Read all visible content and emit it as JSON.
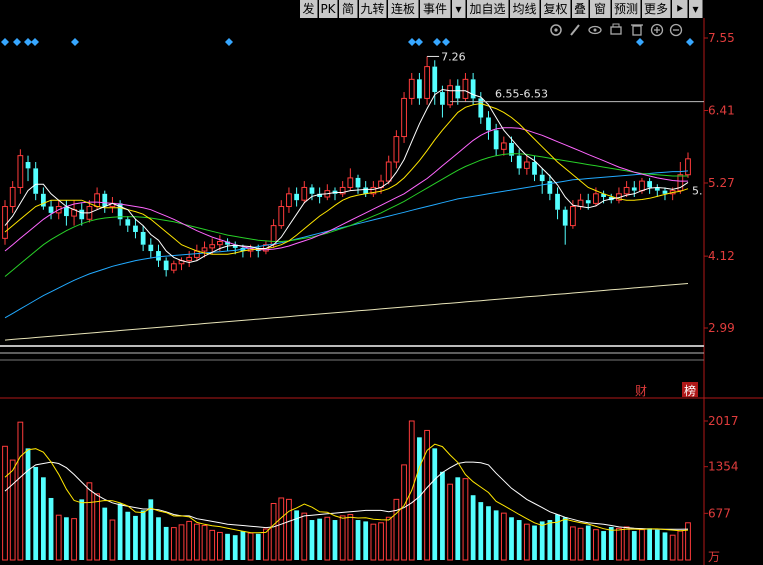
{
  "toolbar": {
    "buttons": [
      {
        "name": "fa",
        "label": "发"
      },
      {
        "name": "pk",
        "label": "PK"
      },
      {
        "name": "jian",
        "label": "简"
      },
      {
        "name": "jiuzhuan",
        "label": "九转"
      },
      {
        "name": "lianban",
        "label": "连板"
      },
      {
        "name": "shijian",
        "label": "事件"
      },
      {
        "name": "dropdown",
        "label": "▾"
      },
      {
        "name": "jiazixuan",
        "label": "加自选"
      },
      {
        "name": "junxian",
        "label": "均线"
      },
      {
        "name": "fuquan",
        "label": "复权"
      },
      {
        "name": "die",
        "label": "叠"
      },
      {
        "name": "chuang",
        "label": "窗"
      },
      {
        "name": "yuce",
        "label": "预测"
      },
      {
        "name": "gengduo",
        "label": "更多"
      },
      {
        "name": "flag",
        "label": "⯈"
      },
      {
        "name": "dropdown2",
        "label": "▾"
      }
    ]
  },
  "colors": {
    "up": "#ff3c3c",
    "down": "#54ffff",
    "axis": "#b01818",
    "ma5": "#ffffff",
    "ma10": "#ffe600",
    "ma20": "#ff66ff",
    "ma30": "#28d028",
    "ma60": "#22aaff",
    "ma250": "#e8e4b8",
    "marker": "#37a7ff"
  },
  "icons": [
    "gear-icon",
    "pencil-icon",
    "eye-icon",
    "print-icon",
    "trash-icon",
    "zoom-in-icon",
    "zoom-out-icon"
  ],
  "price_axis": {
    "ticks": [
      "7.55",
      "6.41",
      "5.27",
      "4.12",
      "2.99"
    ]
  },
  "volume_axis": {
    "ticks": [
      "2017",
      "1354",
      "677"
    ],
    "unit": "万"
  },
  "annotations": {
    "high": "7.26",
    "range": "6.55-6.53",
    "last": "5."
  },
  "badges": {
    "cai": "财",
    "bang": "榜"
  },
  "chart_data": {
    "type": "candlestick",
    "ylim": [
      2.99,
      7.55
    ],
    "volume_ylim": [
      0,
      2017
    ],
    "candles": [
      [
        4.4,
        4.9,
        4.3,
        5.0
      ],
      [
        4.9,
        5.2,
        4.8,
        5.3
      ],
      [
        5.2,
        5.7,
        5.1,
        5.8
      ],
      [
        5.6,
        5.5,
        5.3,
        5.7
      ],
      [
        5.5,
        5.1,
        5.0,
        5.6
      ],
      [
        5.1,
        4.9,
        4.85,
        5.2
      ],
      [
        4.9,
        4.8,
        4.7,
        5.0
      ],
      [
        4.8,
        4.9,
        4.7,
        5.0
      ],
      [
        4.9,
        4.75,
        4.6,
        5.0
      ],
      [
        4.75,
        4.85,
        4.6,
        5.0
      ],
      [
        4.85,
        4.7,
        4.6,
        4.95
      ],
      [
        4.7,
        4.9,
        4.65,
        5.0
      ],
      [
        4.9,
        5.1,
        4.85,
        5.2
      ],
      [
        5.1,
        4.9,
        4.8,
        5.15
      ],
      [
        4.9,
        4.95,
        4.8,
        5.05
      ],
      [
        4.95,
        4.7,
        4.6,
        5.0
      ],
      [
        4.7,
        4.6,
        4.5,
        4.75
      ],
      [
        4.6,
        4.5,
        4.4,
        4.7
      ],
      [
        4.5,
        4.3,
        4.2,
        4.6
      ],
      [
        4.3,
        4.2,
        4.1,
        4.4
      ],
      [
        4.2,
        4.05,
        3.95,
        4.3
      ],
      [
        4.05,
        3.9,
        3.8,
        4.1
      ],
      [
        3.9,
        4.0,
        3.85,
        4.05
      ],
      [
        4.0,
        4.05,
        3.9,
        4.1
      ],
      [
        4.05,
        4.1,
        3.95,
        4.2
      ],
      [
        4.1,
        4.2,
        4.05,
        4.3
      ],
      [
        4.2,
        4.25,
        4.1,
        4.35
      ],
      [
        4.25,
        4.3,
        4.15,
        4.4
      ],
      [
        4.3,
        4.35,
        4.2,
        4.45
      ],
      [
        4.35,
        4.3,
        4.2,
        4.4
      ],
      [
        4.3,
        4.25,
        4.15,
        4.35
      ],
      [
        4.25,
        4.2,
        4.1,
        4.3
      ],
      [
        4.2,
        4.25,
        4.1,
        4.3
      ],
      [
        4.25,
        4.2,
        4.1,
        4.3
      ],
      [
        4.2,
        4.3,
        4.15,
        4.35
      ],
      [
        4.3,
        4.6,
        4.25,
        4.7
      ],
      [
        4.6,
        4.9,
        4.55,
        5.0
      ],
      [
        4.9,
        5.1,
        4.8,
        5.2
      ],
      [
        5.1,
        5.0,
        4.9,
        5.2
      ],
      [
        5.0,
        5.2,
        4.95,
        5.3
      ],
      [
        5.2,
        5.1,
        5.0,
        5.25
      ],
      [
        5.1,
        5.05,
        4.95,
        5.2
      ],
      [
        5.05,
        5.15,
        5.0,
        5.25
      ],
      [
        5.15,
        5.1,
        5.0,
        5.2
      ],
      [
        5.1,
        5.2,
        5.05,
        5.3
      ],
      [
        5.2,
        5.35,
        5.15,
        5.5
      ],
      [
        5.35,
        5.2,
        5.1,
        5.4
      ],
      [
        5.2,
        5.1,
        5.05,
        5.3
      ],
      [
        5.1,
        5.2,
        5.05,
        5.3
      ],
      [
        5.2,
        5.3,
        5.1,
        5.4
      ],
      [
        5.3,
        5.6,
        5.25,
        5.7
      ],
      [
        5.6,
        6.0,
        5.5,
        6.1
      ],
      [
        6.0,
        6.6,
        5.9,
        6.7
      ],
      [
        6.6,
        6.9,
        6.5,
        7.0
      ],
      [
        6.9,
        6.6,
        6.5,
        7.0
      ],
      [
        6.6,
        7.1,
        6.5,
        7.26
      ],
      [
        7.1,
        6.7,
        6.5,
        7.2
      ],
      [
        6.7,
        6.5,
        6.3,
        6.8
      ],
      [
        6.5,
        6.8,
        6.45,
        6.9
      ],
      [
        6.8,
        6.6,
        6.5,
        6.9
      ],
      [
        6.6,
        6.9,
        6.55,
        7.0
      ],
      [
        6.9,
        6.6,
        6.5,
        7.0
      ],
      [
        6.6,
        6.3,
        6.2,
        6.7
      ],
      [
        6.3,
        6.1,
        5.95,
        6.4
      ],
      [
        6.1,
        5.8,
        5.7,
        6.2
      ],
      [
        5.8,
        5.9,
        5.7,
        6.0
      ],
      [
        5.9,
        5.7,
        5.6,
        6.0
      ],
      [
        5.7,
        5.5,
        5.4,
        5.8
      ],
      [
        5.5,
        5.6,
        5.4,
        5.7
      ],
      [
        5.6,
        5.4,
        5.3,
        5.7
      ],
      [
        5.4,
        5.3,
        5.1,
        5.5
      ],
      [
        5.3,
        5.1,
        5.0,
        5.4
      ],
      [
        5.1,
        4.85,
        4.7,
        5.2
      ],
      [
        4.85,
        4.6,
        4.3,
        4.9
      ],
      [
        4.6,
        4.9,
        4.55,
        5.0
      ],
      [
        4.9,
        5.0,
        4.85,
        5.1
      ],
      [
        5.0,
        4.95,
        4.85,
        5.1
      ],
      [
        4.95,
        5.1,
        4.9,
        5.2
      ],
      [
        5.1,
        5.05,
        4.95,
        5.15
      ],
      [
        5.05,
        5.0,
        4.95,
        5.1
      ],
      [
        5.0,
        5.1,
        4.95,
        5.2
      ],
      [
        5.1,
        5.2,
        5.05,
        5.3
      ],
      [
        5.2,
        5.15,
        5.05,
        5.3
      ],
      [
        5.15,
        5.3,
        5.1,
        5.35
      ],
      [
        5.3,
        5.2,
        5.1,
        5.35
      ],
      [
        5.2,
        5.15,
        5.05,
        5.25
      ],
      [
        5.15,
        5.1,
        5.0,
        5.2
      ],
      [
        5.1,
        5.15,
        5.0,
        5.2
      ],
      [
        5.15,
        5.4,
        5.1,
        5.6
      ],
      [
        5.4,
        5.65,
        5.35,
        5.75
      ]
    ],
    "volumes": [
      1650,
      1450,
      2000,
      1620,
      1350,
      1200,
      900,
      650,
      620,
      600,
      880,
      1120,
      960,
      760,
      580,
      820,
      700,
      640,
      720,
      880,
      620,
      480,
      470,
      510,
      560,
      520,
      500,
      430,
      400,
      380,
      360,
      420,
      390,
      380,
      450,
      820,
      900,
      880,
      720,
      680,
      580,
      600,
      620,
      580,
      640,
      660,
      580,
      560,
      520,
      540,
      620,
      880,
      1380,
      2017,
      1780,
      1880,
      1620,
      1280,
      1100,
      1200,
      1180,
      940,
      840,
      780,
      720,
      680,
      620,
      580,
      520,
      500,
      560,
      580,
      660,
      620,
      480,
      460,
      500,
      440,
      420,
      480,
      460,
      480,
      420,
      440,
      460,
      440,
      400,
      360,
      420,
      540
    ],
    "ma5": [
      4.6,
      4.75,
      4.95,
      5.15,
      5.25,
      5.25,
      5.1,
      5.0,
      4.9,
      4.85,
      4.8,
      4.8,
      4.85,
      4.9,
      4.95,
      4.9,
      4.85,
      4.7,
      4.6,
      4.46,
      4.37,
      4.2,
      4.1,
      4.05,
      4.02,
      4.05,
      4.12,
      4.18,
      4.24,
      4.28,
      4.29,
      4.28,
      4.27,
      4.24,
      4.24,
      4.3,
      4.42,
      4.6,
      4.78,
      4.96,
      5.06,
      5.09,
      5.1,
      5.12,
      5.12,
      5.15,
      5.16,
      5.17,
      5.17,
      5.2,
      5.28,
      5.44,
      5.64,
      5.92,
      6.2,
      6.44,
      6.66,
      6.74,
      6.72,
      6.72,
      6.72,
      6.66,
      6.62,
      6.5,
      6.3,
      6.1,
      5.96,
      5.82,
      5.7,
      5.62,
      5.5,
      5.38,
      5.24,
      5.05,
      4.92,
      4.9,
      4.88,
      4.91,
      4.99,
      5.02,
      5.04,
      5.08,
      5.1,
      5.15,
      5.19,
      5.2,
      5.19,
      5.17,
      5.2,
      5.28
    ],
    "ma10": [
      4.5,
      4.6,
      4.7,
      4.8,
      4.9,
      4.95,
      5.0,
      5.0,
      5.0,
      5.0,
      5.0,
      4.95,
      4.9,
      4.88,
      4.88,
      4.88,
      4.85,
      4.82,
      4.78,
      4.7,
      4.6,
      4.5,
      4.4,
      4.3,
      4.25,
      4.2,
      4.17,
      4.15,
      4.15,
      4.15,
      4.17,
      4.2,
      4.22,
      4.23,
      4.24,
      4.26,
      4.3,
      4.36,
      4.45,
      4.55,
      4.65,
      4.75,
      4.83,
      4.92,
      5.0,
      5.05,
      5.08,
      5.1,
      5.12,
      5.14,
      5.18,
      5.25,
      5.35,
      5.48,
      5.62,
      5.78,
      5.95,
      6.1,
      6.24,
      6.38,
      6.46,
      6.5,
      6.52,
      6.48,
      6.44,
      6.38,
      6.3,
      6.2,
      6.08,
      5.96,
      5.84,
      5.72,
      5.6,
      5.5,
      5.4,
      5.3,
      5.2,
      5.15,
      5.1,
      5.06,
      5.02,
      5.0,
      5.0,
      5.01,
      5.03,
      5.06,
      5.09,
      5.12,
      5.14,
      5.18
    ],
    "ma20": [
      4.2,
      4.3,
      4.4,
      4.5,
      4.6,
      4.7,
      4.78,
      4.85,
      4.9,
      4.94,
      4.96,
      4.97,
      4.97,
      4.96,
      4.95,
      4.94,
      4.92,
      4.9,
      4.88,
      4.85,
      4.8,
      4.75,
      4.7,
      4.64,
      4.58,
      4.52,
      4.47,
      4.42,
      4.38,
      4.34,
      4.3,
      4.27,
      4.24,
      4.22,
      4.22,
      4.23,
      4.25,
      4.28,
      4.32,
      4.36,
      4.4,
      4.45,
      4.5,
      4.56,
      4.62,
      4.68,
      4.74,
      4.8,
      4.86,
      4.92,
      4.98,
      5.04,
      5.1,
      5.18,
      5.26,
      5.34,
      5.44,
      5.54,
      5.64,
      5.74,
      5.84,
      5.94,
      6.02,
      6.08,
      6.12,
      6.14,
      6.14,
      6.13,
      6.1,
      6.06,
      6.02,
      5.97,
      5.92,
      5.87,
      5.82,
      5.77,
      5.72,
      5.67,
      5.62,
      5.57,
      5.52,
      5.48,
      5.44,
      5.41,
      5.38,
      5.35,
      5.33,
      5.31,
      5.3,
      5.3
    ],
    "ma30": [
      3.8,
      3.9,
      4.0,
      4.1,
      4.2,
      4.3,
      4.38,
      4.45,
      4.52,
      4.58,
      4.63,
      4.67,
      4.7,
      4.72,
      4.73,
      4.74,
      4.74,
      4.74,
      4.73,
      4.72,
      4.7,
      4.68,
      4.66,
      4.63,
      4.6,
      4.57,
      4.54,
      4.51,
      4.48,
      4.45,
      4.43,
      4.41,
      4.39,
      4.37,
      4.36,
      4.35,
      4.35,
      4.36,
      4.38,
      4.4,
      4.42,
      4.45,
      4.48,
      4.52,
      4.56,
      4.6,
      4.65,
      4.7,
      4.75,
      4.8,
      4.86,
      4.92,
      4.98,
      5.05,
      5.12,
      5.19,
      5.26,
      5.33,
      5.4,
      5.47,
      5.53,
      5.58,
      5.63,
      5.67,
      5.7,
      5.72,
      5.73,
      5.73,
      5.72,
      5.7,
      5.68,
      5.66,
      5.64,
      5.62,
      5.6,
      5.58,
      5.56,
      5.54,
      5.52,
      5.5,
      5.48,
      5.46,
      5.44,
      5.42,
      5.41,
      5.4,
      5.39,
      5.38,
      5.38,
      5.38
    ],
    "ma60": [
      3.15,
      3.22,
      3.29,
      3.36,
      3.43,
      3.5,
      3.56,
      3.62,
      3.68,
      3.74,
      3.79,
      3.84,
      3.88,
      3.92,
      3.96,
      3.99,
      4.02,
      4.05,
      4.07,
      4.09,
      4.11,
      4.12,
      4.13,
      4.14,
      4.15,
      4.16,
      4.17,
      4.18,
      4.19,
      4.2,
      4.21,
      4.23,
      4.25,
      4.27,
      4.29,
      4.31,
      4.33,
      4.36,
      4.39,
      4.42,
      4.45,
      4.48,
      4.51,
      4.54,
      4.57,
      4.6,
      4.63,
      4.66,
      4.69,
      4.72,
      4.75,
      4.78,
      4.81,
      4.84,
      4.87,
      4.9,
      4.93,
      4.96,
      4.99,
      5.02,
      5.04,
      5.06,
      5.08,
      5.1,
      5.12,
      5.14,
      5.16,
      5.18,
      5.2,
      5.22,
      5.24,
      5.26,
      5.28,
      5.3,
      5.32,
      5.33,
      5.34,
      5.35,
      5.36,
      5.37,
      5.38,
      5.39,
      5.4,
      5.41,
      5.42,
      5.43,
      5.44,
      5.45,
      5.45,
      5.46
    ],
    "ma250": [
      2.8,
      2.81,
      2.82,
      2.83,
      2.84,
      2.85,
      2.86,
      2.87,
      2.88,
      2.89,
      2.9,
      2.91,
      2.92,
      2.93,
      2.94,
      2.95,
      2.96,
      2.97,
      2.98,
      2.99,
      3.0,
      3.01,
      3.02,
      3.03,
      3.04,
      3.05,
      3.06,
      3.07,
      3.08,
      3.09,
      3.1,
      3.11,
      3.12,
      3.13,
      3.14,
      3.15,
      3.16,
      3.17,
      3.18,
      3.19,
      3.2,
      3.21,
      3.22,
      3.23,
      3.24,
      3.25,
      3.26,
      3.27,
      3.28,
      3.29,
      3.3,
      3.31,
      3.32,
      3.33,
      3.34,
      3.35,
      3.36,
      3.37,
      3.38,
      3.39,
      3.4,
      3.41,
      3.42,
      3.43,
      3.44,
      3.45,
      3.46,
      3.47,
      3.48,
      3.49,
      3.5,
      3.51,
      3.52,
      3.53,
      3.54,
      3.55,
      3.56,
      3.57,
      3.58,
      3.59,
      3.6,
      3.61,
      3.62,
      3.63,
      3.64,
      3.65,
      3.66,
      3.67,
      3.68,
      3.69
    ],
    "vol_ma5": [
      1200,
      1300,
      1500,
      1600,
      1615,
      1564,
      1424,
      1244,
      1028,
      864,
      830,
      834,
      847,
      864,
      860,
      828,
      784,
      696,
      688,
      752,
      712,
      688,
      638,
      640,
      626,
      546,
      518,
      498,
      484,
      462,
      438,
      418,
      398,
      394,
      400,
      510,
      612,
      706,
      756,
      812,
      766,
      700,
      694,
      640,
      606,
      620,
      610,
      614,
      592,
      584,
      580,
      676,
      790,
      1010,
      1346,
      1592,
      1680,
      1646,
      1524,
      1416,
      1240,
      1136,
      1058,
      980,
      852,
      790,
      726,
      660,
      600,
      540,
      500,
      538,
      548,
      594,
      564,
      540,
      522,
      488,
      454,
      432,
      436,
      450,
      448,
      444,
      452,
      452,
      442,
      434,
      424,
      434
    ],
    "vol_ma10": [
      1000,
      1100,
      1200,
      1300,
      1380,
      1400,
      1420,
      1400,
      1340,
      1240,
      1130,
      1020,
      940,
      880,
      830,
      800,
      780,
      760,
      740,
      740,
      730,
      700,
      660,
      640,
      640,
      600,
      580,
      560,
      540,
      520,
      510,
      500,
      490,
      480,
      470,
      480,
      520,
      560,
      600,
      640,
      650,
      660,
      670,
      680,
      690,
      700,
      710,
      720,
      720,
      720,
      700,
      720,
      760,
      830,
      920,
      1050,
      1170,
      1270,
      1340,
      1400,
      1420,
      1420,
      1410,
      1380,
      1260,
      1150,
      1040,
      960,
      880,
      820,
      760,
      700,
      660,
      620,
      590,
      560,
      540,
      530,
      520,
      500,
      480,
      470,
      460,
      455,
      450,
      448,
      446,
      445,
      445,
      448
    ]
  }
}
